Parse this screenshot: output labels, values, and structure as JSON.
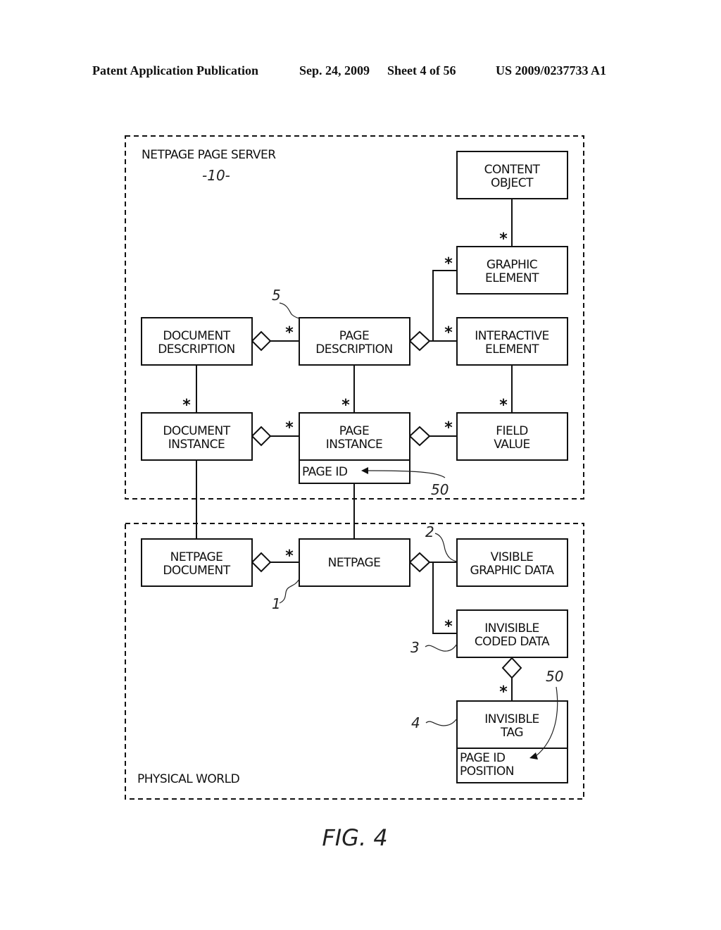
{
  "header": {
    "left": "Patent Application Publication",
    "date": "Sep. 24, 2009",
    "sheet": "Sheet 4 of 56",
    "number": "US 2009/0237733 A1"
  },
  "regions": {
    "server": {
      "label": "NETPAGE PAGE SERVER",
      "ref": "-10-"
    },
    "physical": {
      "label": "PHYSICAL WORLD"
    }
  },
  "boxes": {
    "content_object": [
      "CONTENT",
      "OBJECT"
    ],
    "graphic_element": [
      "GRAPHIC",
      "ELEMENT"
    ],
    "document_description": [
      "DOCUMENT",
      "DESCRIPTION"
    ],
    "page_description": [
      "PAGE",
      "DESCRIPTION"
    ],
    "interactive_element": [
      "INTERACTIVE",
      "ELEMENT"
    ],
    "document_instance": [
      "DOCUMENT",
      "INSTANCE"
    ],
    "page_instance": [
      "PAGE",
      "INSTANCE"
    ],
    "page_instance_attr": "PAGE ID",
    "field_value": [
      "FIELD",
      "VALUE"
    ],
    "netpage_document": [
      "NETPAGE",
      "DOCUMENT"
    ],
    "netpage": "NETPAGE",
    "visible_graphic_data": [
      "VISIBLE",
      "GRAPHIC DATA"
    ],
    "invisible_coded_data": [
      "INVISIBLE",
      "CODED DATA"
    ],
    "invisible_tag": [
      "INVISIBLE",
      "TAG"
    ],
    "invisible_tag_attrs": [
      "PAGE ID",
      "POSITION"
    ]
  },
  "multiplicity": "*",
  "refs": {
    "page_description": "5",
    "page_id_server": "50",
    "visible_graphic_data": "2",
    "netpage": "1",
    "invisible_coded_data": "3",
    "invisible_tag": "4",
    "page_id_tag": "50"
  },
  "figure_caption": "FIG. 4"
}
